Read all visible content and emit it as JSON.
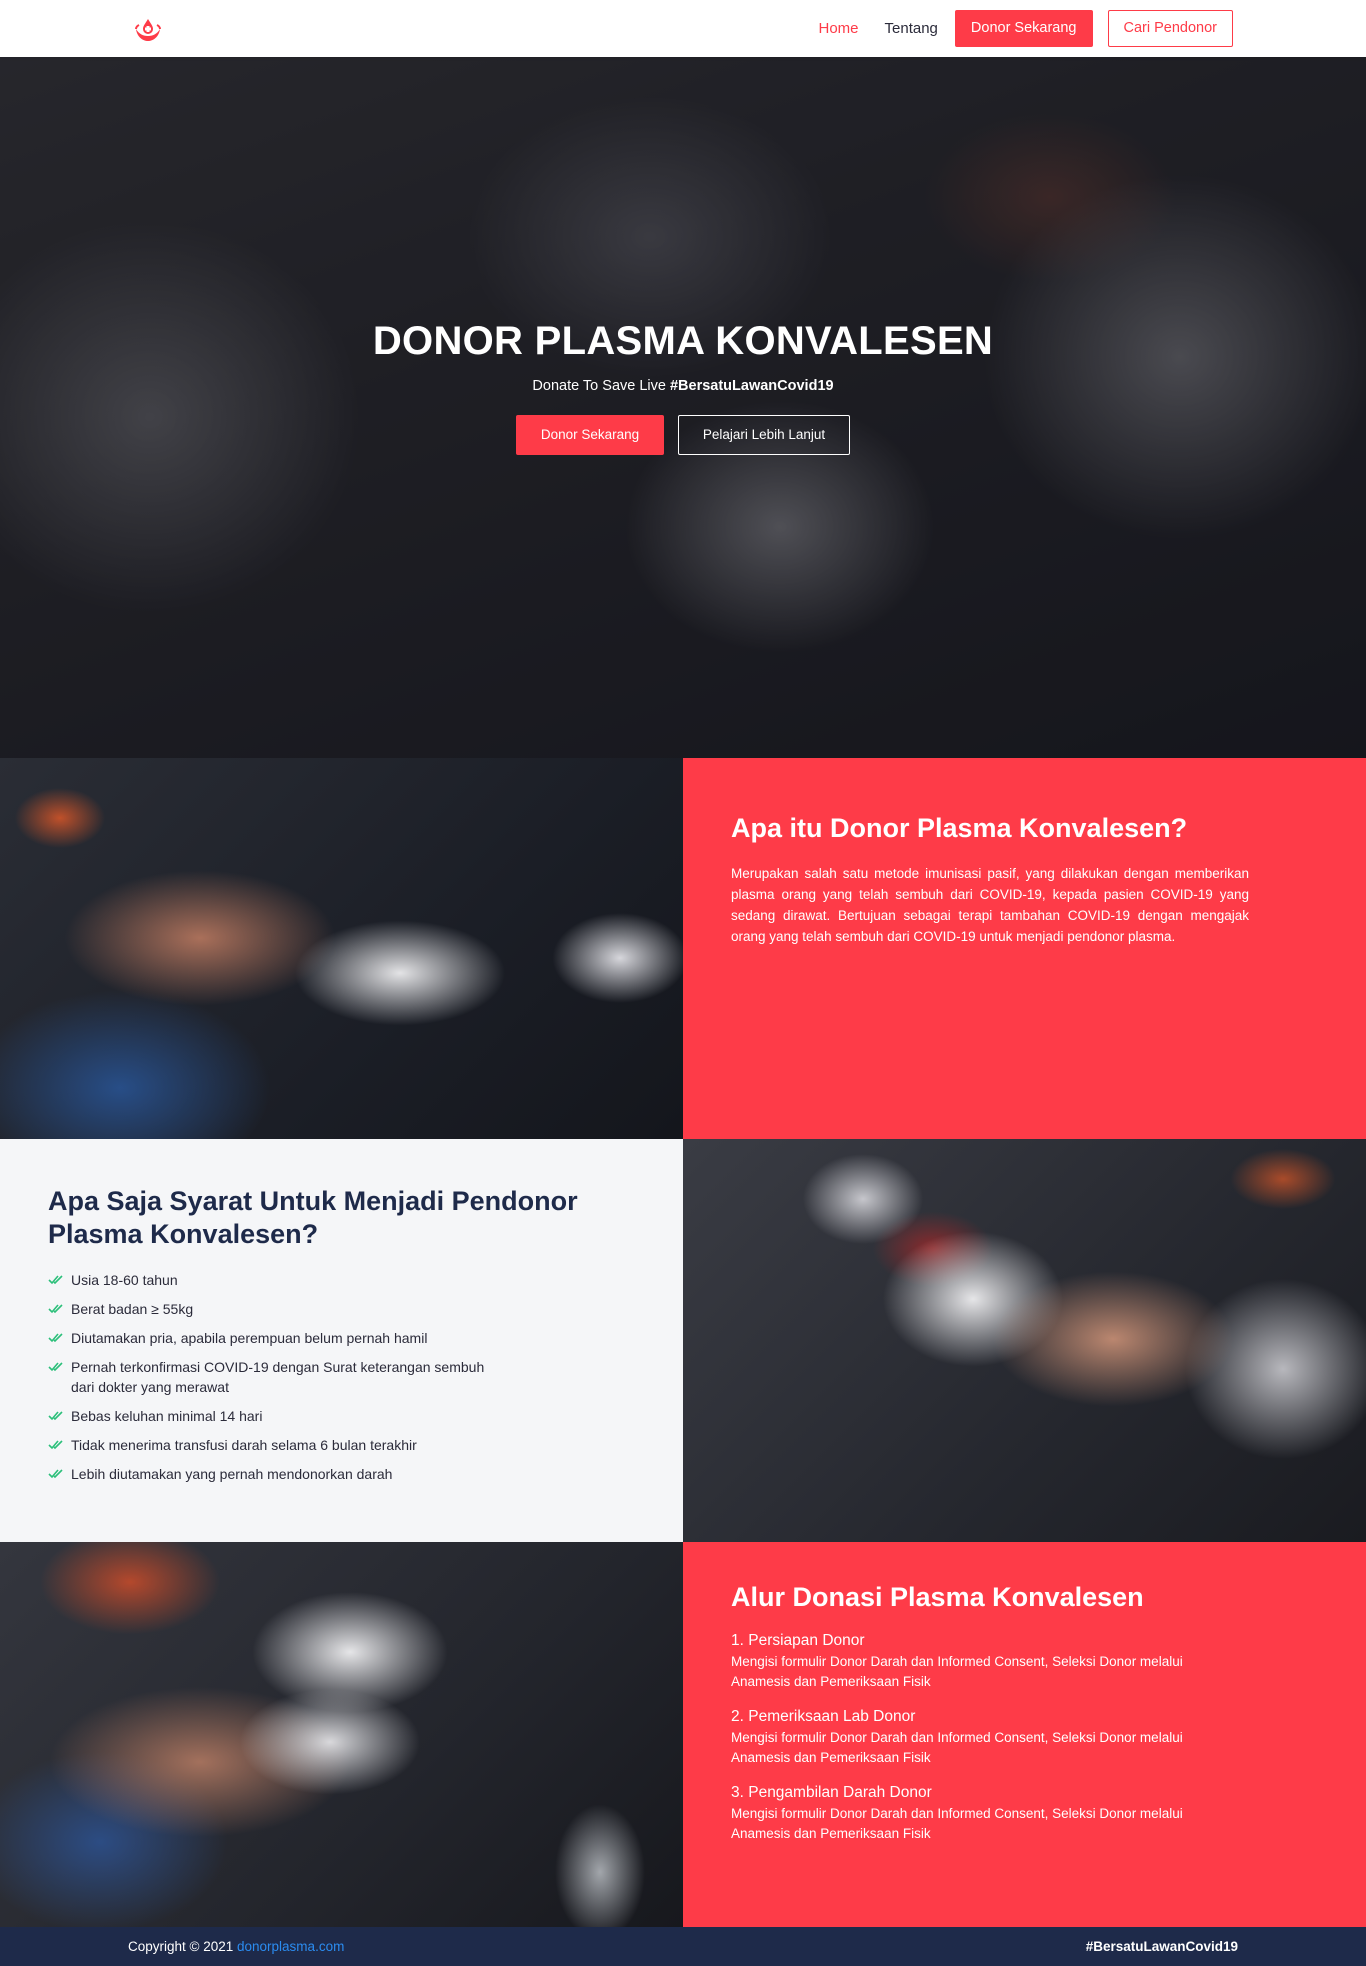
{
  "colors": {
    "accent": "#fe3b48",
    "navy": "#1e2a4a",
    "link": "#2b8cf0"
  },
  "nav": {
    "logo_icon": "blood-drop-hands-icon",
    "home": "Home",
    "about": "Tentang",
    "donate": "Donor Sekarang",
    "find": "Cari Pendonor"
  },
  "hero": {
    "title": "DONOR PLASMA KONVALESEN",
    "subtitle": "Donate To Save Live ",
    "hashtag": "#BersatuLawanCovid19",
    "btn_donate": "Donor Sekarang",
    "btn_learn": "Pelajari Lebih Lanjut"
  },
  "about": {
    "title": "Apa itu Donor Plasma Konvalesen?",
    "text": "Merupakan salah satu metode imunisasi pasif, yang dilakukan dengan memberikan plasma orang yang telah sembuh dari COVID-19, kepada pasien COVID-19 yang sedang dirawat. Bertujuan sebagai terapi tambahan COVID-19 dengan mengajak orang yang telah sembuh dari COVID-19 untuk menjadi pendonor plasma."
  },
  "requirements": {
    "title": "Apa Saja Syarat Untuk Menjadi Pendonor Plasma Konvalesen?",
    "items": [
      "Usia 18-60 tahun",
      "Berat badan ≥ 55kg",
      "Diutamakan pria, apabila perempuan belum pernah hamil",
      "Pernah terkonfirmasi COVID-19 dengan Surat keterangan sembuh dari dokter yang merawat",
      "Bebas keluhan minimal 14 hari",
      "Tidak menerima transfusi darah selama 6 bulan terakhir",
      "Lebih diutamakan yang pernah mendonorkan darah"
    ]
  },
  "flow": {
    "title": "Alur Donasi Plasma Konvalesen",
    "steps": [
      {
        "title": "1. Persiapan Donor",
        "desc": "Mengisi formulir Donor Darah dan Informed Consent, Seleksi Donor melalui Anamesis dan Pemeriksaan Fisik"
      },
      {
        "title": "2. Pemeriksaan Lab Donor",
        "desc": "Mengisi formulir Donor Darah dan Informed Consent, Seleksi Donor melalui Anamesis dan Pemeriksaan Fisik"
      },
      {
        "title": "3. Pengambilan Darah Donor",
        "desc": "Mengisi formulir Donor Darah dan Informed Consent, Seleksi Donor melalui Anamesis dan Pemeriksaan Fisik"
      }
    ]
  },
  "footer": {
    "copyright": "Copyright © 2021 ",
    "site": "donorplasma.com",
    "hashtag": "#BersatuLawanCovid19"
  }
}
